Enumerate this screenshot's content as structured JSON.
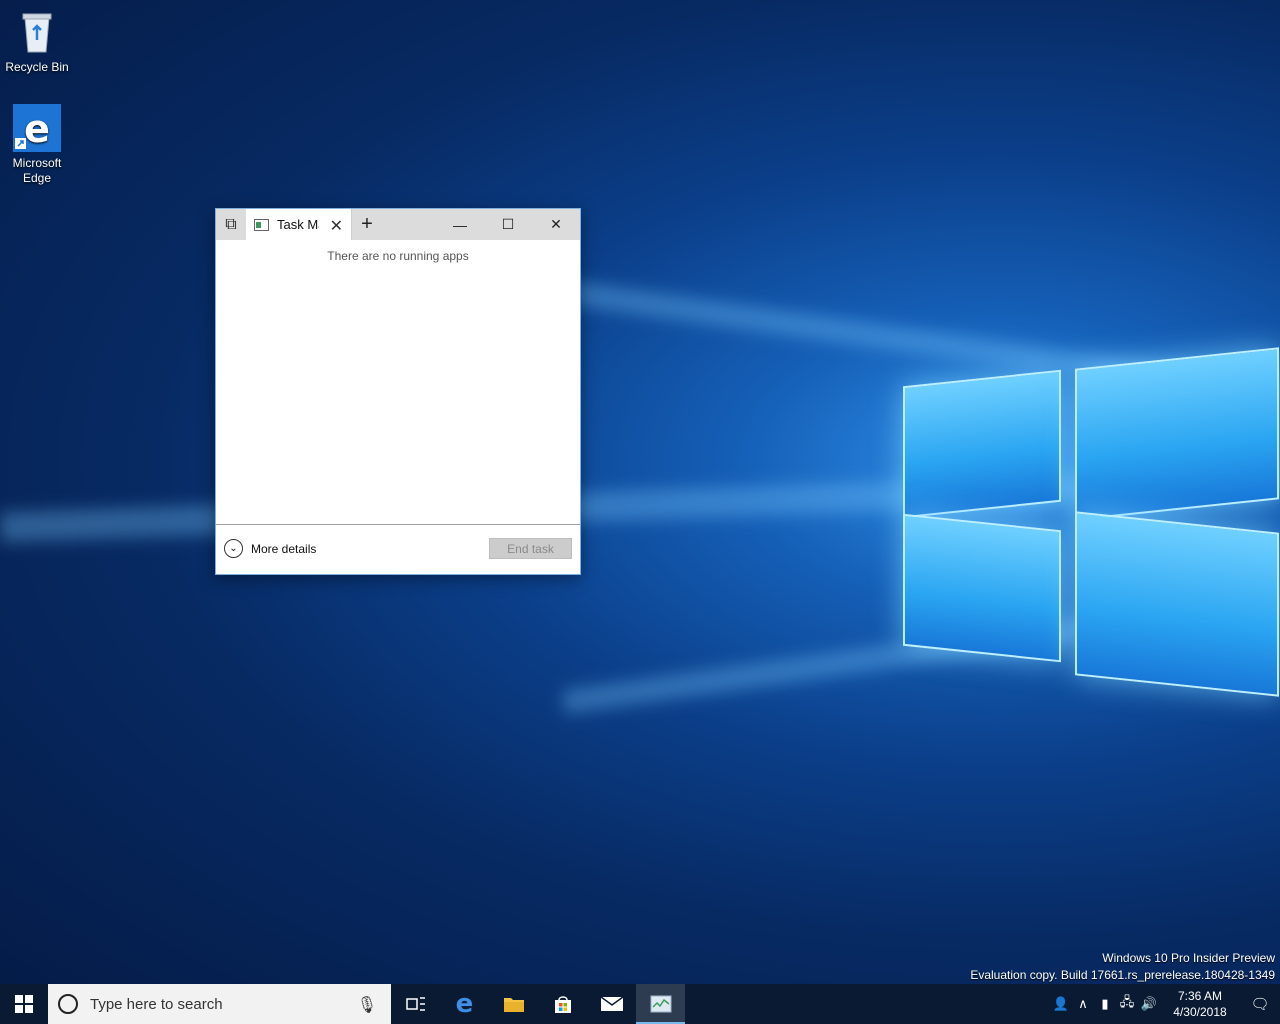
{
  "desktop": {
    "icons": [
      {
        "label": "Recycle Bin",
        "icon": "recycle-bin-icon"
      },
      {
        "label": "Microsoft Edge",
        "icon": "edge-icon"
      }
    ]
  },
  "window": {
    "tab_label": "Task Manager",
    "empty_message": "There are no running apps",
    "more_details_label": "More details",
    "end_task_label": "End task"
  },
  "watermark": {
    "line1": "Windows 10 Pro Insider Preview",
    "line2": "Evaluation copy. Build 17661.rs_prerelease.180428-1349"
  },
  "taskbar": {
    "search_placeholder": "Type here to search",
    "apps": [
      "task-view-icon",
      "edge-icon",
      "file-explorer-icon",
      "store-icon",
      "mail-icon",
      "task-manager-icon"
    ],
    "clock_time": "7:36 AM",
    "clock_date": "4/30/2018"
  }
}
